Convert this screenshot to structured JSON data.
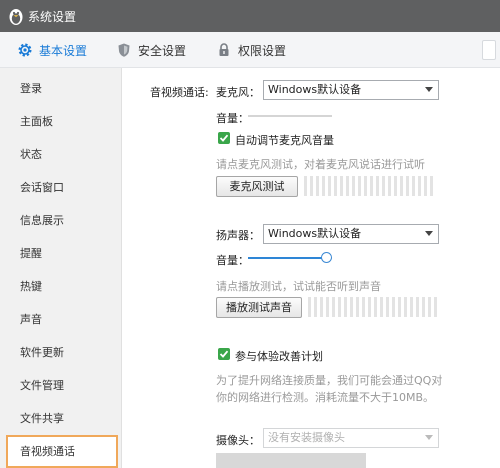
{
  "window": {
    "title": "系统设置"
  },
  "tabs": [
    {
      "label": "基本设置",
      "icon": "gear-icon",
      "active": true
    },
    {
      "label": "安全设置",
      "icon": "shield-icon",
      "active": false
    },
    {
      "label": "权限设置",
      "icon": "lock-icon",
      "active": false
    }
  ],
  "sidebar": {
    "items": [
      {
        "label": "登录"
      },
      {
        "label": "主面板"
      },
      {
        "label": "状态"
      },
      {
        "label": "会话窗口"
      },
      {
        "label": "信息展示"
      },
      {
        "label": "提醒"
      },
      {
        "label": "热键"
      },
      {
        "label": "声音"
      },
      {
        "label": "软件更新"
      },
      {
        "label": "文件管理"
      },
      {
        "label": "文件共享"
      },
      {
        "label": "音视频通话",
        "active": true
      }
    ]
  },
  "av": {
    "section_label": "音视频通话:",
    "mic": {
      "label": "麦克风：",
      "device": "Windows默认设备",
      "volume_label": "音量：",
      "auto_adjust_label": "自动调节麦克风音量",
      "auto_adjust_checked": true,
      "test_hint": "请点麦克风测试，对着麦克风说话进行试听",
      "test_button": "麦克风测试"
    },
    "speaker": {
      "label": "扬声器：",
      "device": "Windows默认设备",
      "volume_label": "音量：",
      "volume_level": 1.0,
      "test_hint": "请点播放测试，试试能否听到声音",
      "test_button": "播放测试声音"
    },
    "improve": {
      "label": "参与体验改善计划",
      "checked": true,
      "description_line1": "为了提升网络连接质量，我们可能会通过QQ对",
      "description_line2": "你的网络进行检测。消耗流量不大于10MB。"
    },
    "camera": {
      "label": "摄像头：",
      "device": "没有安装摄像头"
    }
  },
  "colors": {
    "titlebar": "#5f6061",
    "accent": "#1a7bd7",
    "check": "#3aa64a",
    "active_border": "#f0a85a"
  }
}
